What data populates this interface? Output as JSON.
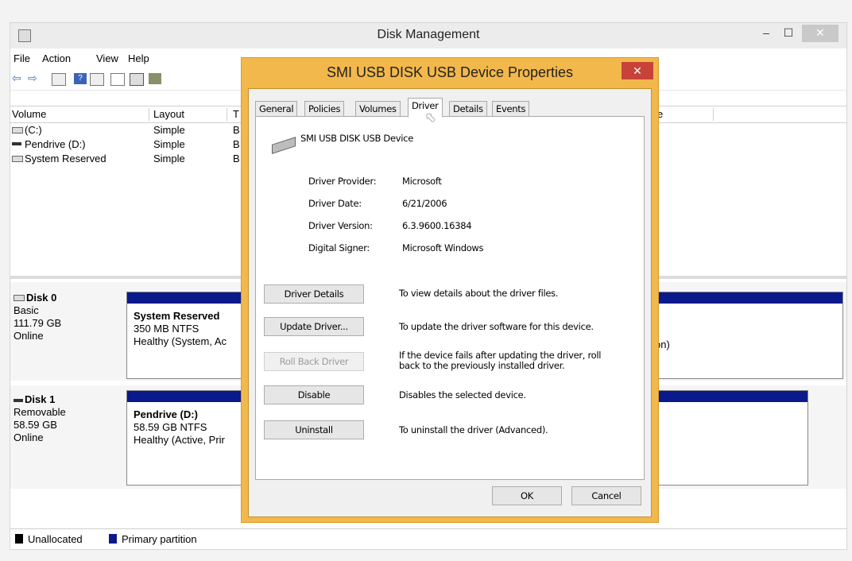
{
  "window": {
    "title": "Disk Management",
    "minimize": "–",
    "maximize": "☐",
    "close": "✕"
  },
  "menu": [
    "File",
    "Action",
    "View",
    "Help"
  ],
  "volume_table": {
    "headers": [
      "Volume",
      "Layout",
      "T",
      "e"
    ],
    "rows": [
      {
        "volume": "(C:)",
        "layout": "Simple",
        "type": "B"
      },
      {
        "volume": "Pendrive (D:)",
        "layout": "Simple",
        "type": "B"
      },
      {
        "volume": "System Reserved",
        "layout": "Simple",
        "type": "B"
      }
    ]
  },
  "disks": [
    {
      "name": "Disk 0",
      "type": "Basic",
      "size": "111.79 GB",
      "status": "Online",
      "partition_name": "System Reserved",
      "partition_fs": "350 MB NTFS",
      "partition_health": "Healthy (System, Ac",
      "right_fragment": "on)"
    },
    {
      "name": "Disk 1",
      "type": "Removable",
      "size": "58.59 GB",
      "status": "Online",
      "partition_name": "Pendrive  (D:)",
      "partition_fs": "58.59 GB NTFS",
      "partition_health": "Healthy (Active, Prir"
    }
  ],
  "legend": {
    "unallocated": "Unallocated",
    "primary": "Primary partition"
  },
  "dialog": {
    "title": "SMI USB DISK USB Device Properties",
    "close": "✕",
    "tabs": [
      "General",
      "Policies",
      "Volumes",
      "Driver",
      "Details",
      "Events"
    ],
    "active_tab": "Driver",
    "device_name": "SMI USB DISK USB Device",
    "fields": [
      {
        "label": "Driver Provider:",
        "value": "Microsoft"
      },
      {
        "label": "Driver Date:",
        "value": "6/21/2006"
      },
      {
        "label": "Driver Version:",
        "value": "6.3.9600.16384"
      },
      {
        "label": "Digital Signer:",
        "value": "Microsoft Windows"
      }
    ],
    "actions": [
      {
        "button": "Driver Details",
        "description": "To view details about the driver files."
      },
      {
        "button": "Update Driver...",
        "description": "To update the driver software for this device."
      },
      {
        "button": "Roll Back Driver",
        "description": "If the device fails after updating the driver, roll back to the previously installed driver."
      },
      {
        "button": "Disable",
        "description": "Disables the selected device."
      },
      {
        "button": "Uninstall",
        "description": "To uninstall the driver (Advanced)."
      }
    ],
    "ok": "OK",
    "cancel": "Cancel"
  },
  "colors": {
    "primary_partition": "#0a1a8c",
    "dialog_frame": "#f2b84b",
    "close_red": "#c7433a"
  }
}
